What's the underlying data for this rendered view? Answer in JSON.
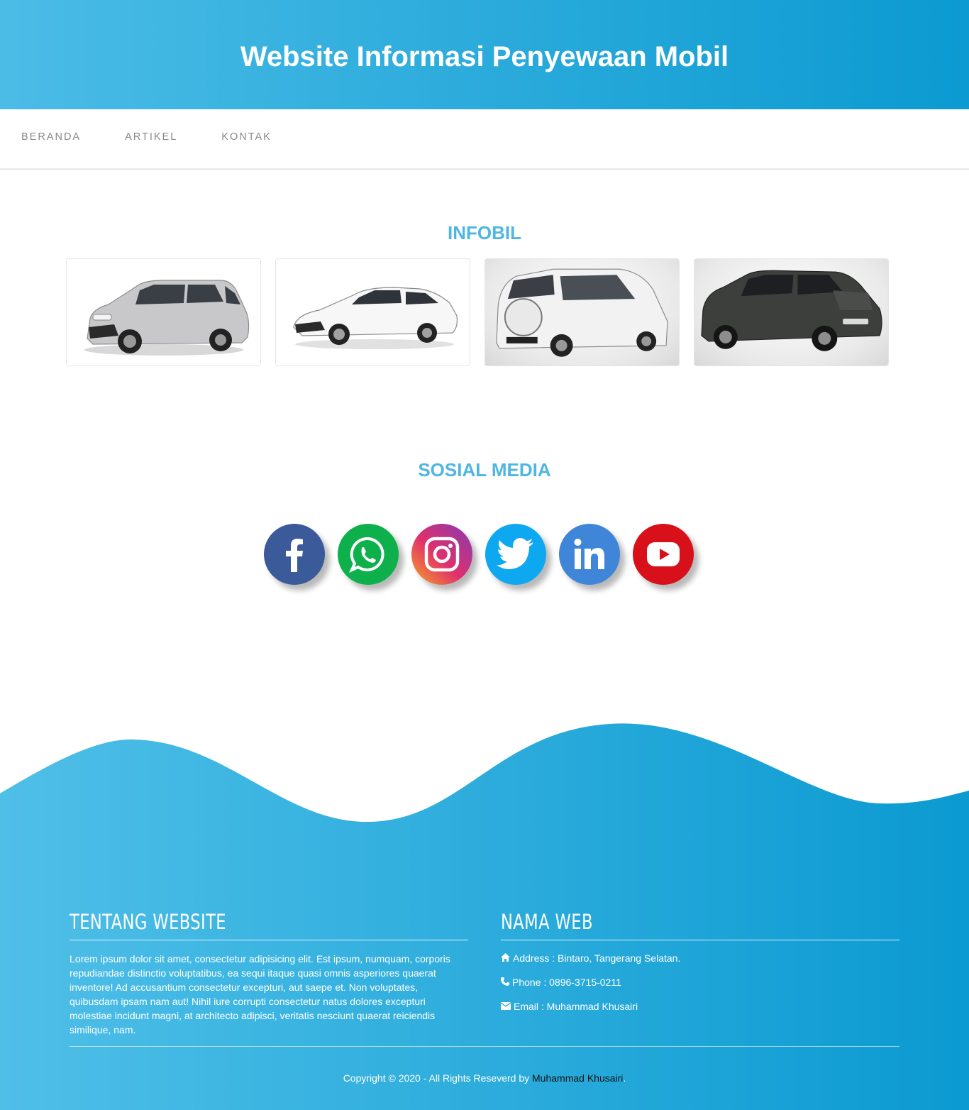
{
  "header": {
    "title": "Website Informasi Penyewaan Mobil"
  },
  "nav": {
    "items": [
      "BERANDA",
      "ARTIKEL",
      "KONTAK"
    ]
  },
  "infobil": {
    "title": "INFOBIL"
  },
  "social": {
    "title": "SOSIAL MEDIA",
    "icons": [
      "facebook-icon",
      "whatsapp-icon",
      "instagram-icon",
      "twitter-icon",
      "linkedin-icon",
      "youtube-icon"
    ]
  },
  "footer": {
    "about": {
      "title": "TENTANG WEBSITE",
      "text": "Lorem ipsum dolor sit amet, consectetur adipisicing elit. Est ipsum, numquam, corporis repudiandae distinctio voluptatibus, ea sequi itaque quasi omnis asperiores quaerat inventore! Ad accusantium consectetur excepturi, aut saepe et. Non voluptates, quibusdam ipsam nam aut! Nihil iure corrupti consectetur natus dolores excepturi molestiae incidunt magni, at architecto adipisci, veritatis nesciunt quaerat reiciendis similique, nam."
    },
    "web": {
      "title": "NAMA WEB",
      "address": "Address : Bintaro, Tangerang Selatan.",
      "phone": "Phone : 0896-3715-0211",
      "email": "Email : Muhammad Khusairi"
    },
    "copyright_prefix": "Copyright © 2020 - All Rights Reseverd by ",
    "copyright_author": "Muhammad Khusairi",
    "copyright_suffix": "."
  },
  "colors": {
    "header_start": "#4bbce6",
    "header_end": "#0b9ad1",
    "section_title": "#4fb6e2"
  }
}
